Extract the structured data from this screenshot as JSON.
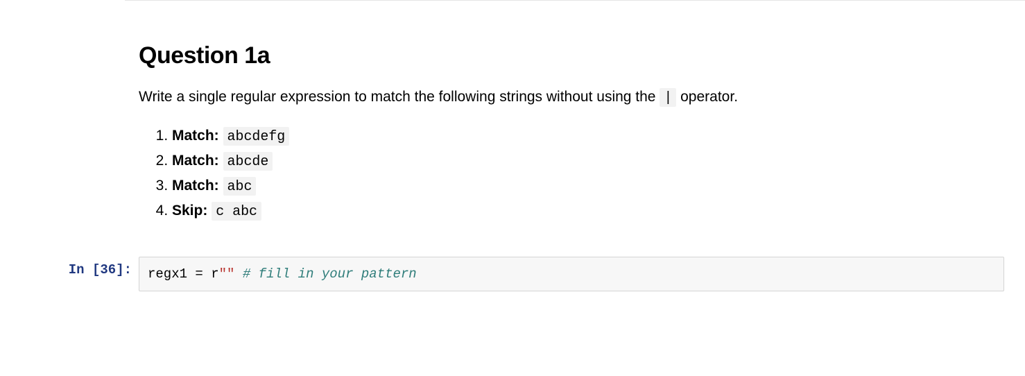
{
  "heading": "Question 1a",
  "description_pre": "Write a single regular expression to match the following strings without using the ",
  "description_operator": "|",
  "description_post": " operator.",
  "examples": [
    {
      "label": "Match:",
      "value": "abcdefg"
    },
    {
      "label": "Match:",
      "value": "abcde"
    },
    {
      "label": "Match:",
      "value": "abc"
    },
    {
      "label": "Skip:",
      "value": "c abc"
    }
  ],
  "code_cell": {
    "prompt_prefix": "In [",
    "exec_count": "36",
    "prompt_suffix": "]:",
    "code_var": "regx1",
    "code_sp1": " ",
    "code_op": "=",
    "code_sp2": " ",
    "code_r": "r",
    "code_str": "\"\"",
    "code_sp3": " ",
    "code_comment": "# fill in your pattern"
  }
}
